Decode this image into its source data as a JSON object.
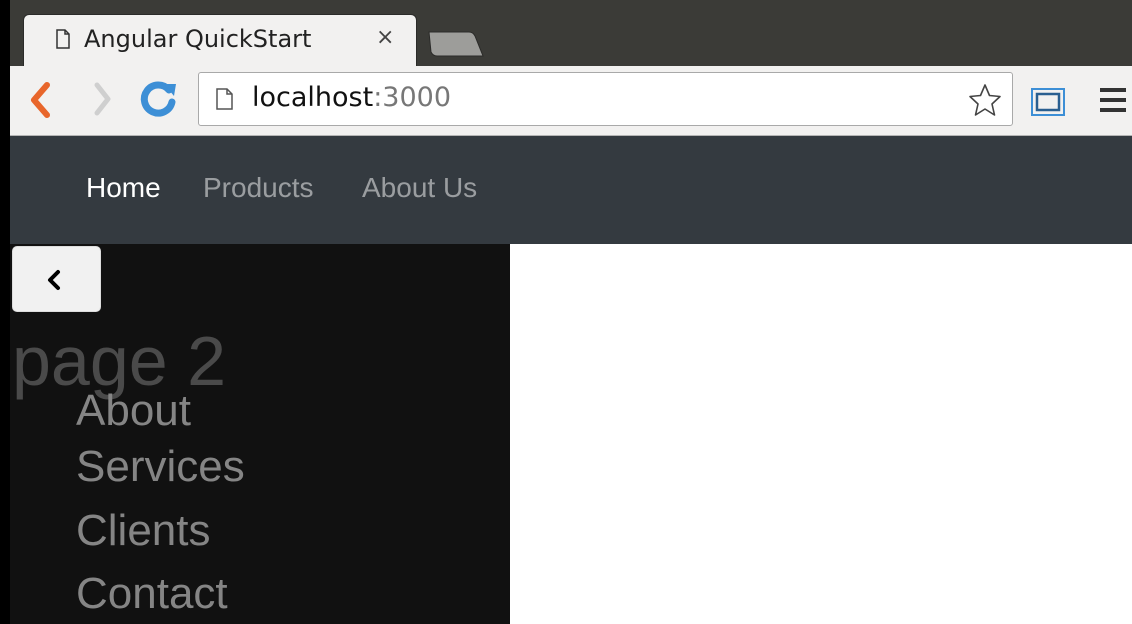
{
  "browser": {
    "tab_title": "Angular QuickStart",
    "tab_close": "×",
    "url_host": "localhost",
    "url_port": ":3000"
  },
  "navbar": {
    "links": [
      {
        "label": "Home",
        "active": true
      },
      {
        "label": "Products",
        "active": false
      },
      {
        "label": "About Us",
        "active": false
      }
    ]
  },
  "sidebar": {
    "toggle_icon": "chevron-left-icon",
    "heading": "page 2",
    "links": [
      "About",
      "Services",
      "Clients",
      "Contact"
    ]
  },
  "colors": {
    "navbar_bg": "#343a40",
    "sidebar_bg": "#111111",
    "back_arrow": "#e8662b",
    "reload": "#3d8fd6"
  }
}
